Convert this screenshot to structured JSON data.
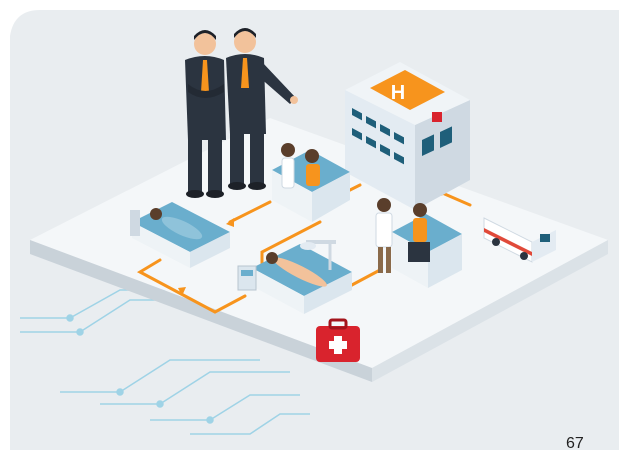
{
  "page": {
    "page_number": "67"
  },
  "illustration": {
    "hospital_sign_letter": "H",
    "colors": {
      "background_panel": "#e9edf0",
      "floor": "#f4f7f9",
      "floor_edge": "#c9d2d9",
      "flow_arrow": "#f7941d",
      "building": "#e3ebf2",
      "window": "#1f5f7a",
      "bed": "#6aaecd",
      "suit": "#2b3440",
      "tie": "#f7941d",
      "first_aid_kit": "#d9232d",
      "ambulance_stripe": "#e04a3a",
      "circuit_lines": "#9fd3e6"
    }
  }
}
